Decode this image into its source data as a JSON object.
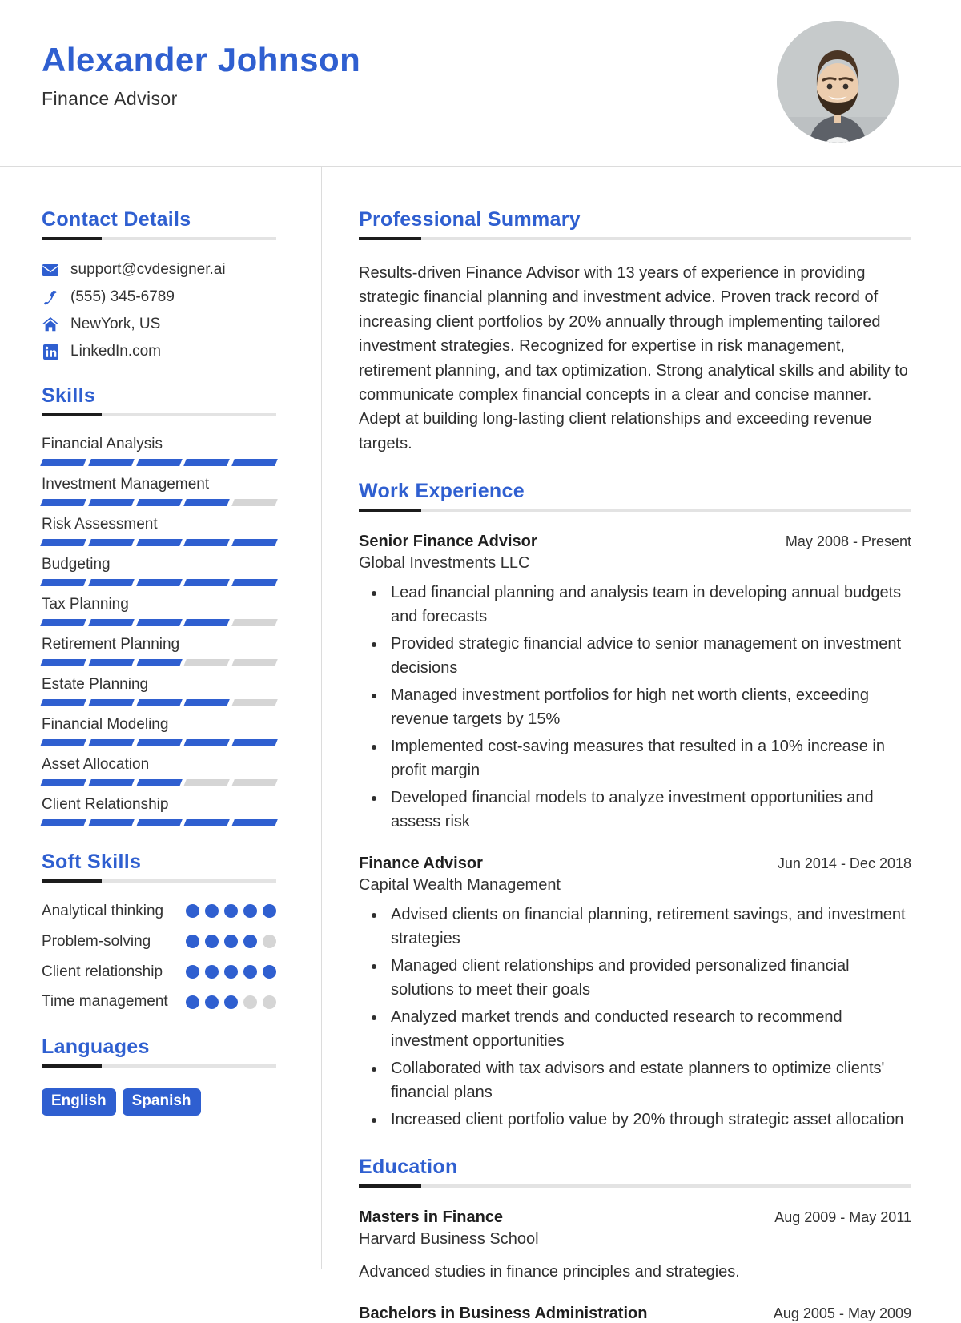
{
  "theme": {
    "accent": "#2f5fd0",
    "rule_dark": "#1c1c1c",
    "rule_light": "#e3e3e3",
    "muted": "#d5d5d5"
  },
  "header": {
    "name": "Alexander Johnson",
    "job_title": "Finance Advisor",
    "avatar_icon": "profile-photo"
  },
  "sidebar": {
    "contact": {
      "heading": "Contact Details",
      "items": [
        {
          "icon": "envelope-icon",
          "text": "support@cvdesigner.ai"
        },
        {
          "icon": "phone-icon",
          "text": "(555) 345-6789"
        },
        {
          "icon": "home-icon",
          "text": "NewYork, US"
        },
        {
          "icon": "linkedin-icon",
          "text": "LinkedIn.com"
        }
      ]
    },
    "skills": {
      "heading": "Skills",
      "max": 5,
      "items": [
        {
          "label": "Financial Analysis",
          "level": 5
        },
        {
          "label": "Investment Management",
          "level": 4
        },
        {
          "label": "Risk Assessment",
          "level": 5
        },
        {
          "label": "Budgeting",
          "level": 5
        },
        {
          "label": "Tax Planning",
          "level": 4
        },
        {
          "label": "Retirement Planning",
          "level": 3
        },
        {
          "label": "Estate Planning",
          "level": 4
        },
        {
          "label": "Financial Modeling",
          "level": 5
        },
        {
          "label": "Asset Allocation",
          "level": 3
        },
        {
          "label": "Client Relationship",
          "level": 5
        }
      ]
    },
    "soft_skills": {
      "heading": "Soft Skills",
      "max": 5,
      "items": [
        {
          "label": "Analytical thinking",
          "level": 5
        },
        {
          "label": "Problem-solving",
          "level": 4
        },
        {
          "label": "Client relationship",
          "level": 5
        },
        {
          "label": "Time management",
          "level": 3
        }
      ]
    },
    "languages": {
      "heading": "Languages",
      "items": [
        "English",
        "Spanish"
      ]
    }
  },
  "main": {
    "summary": {
      "heading": "Professional Summary",
      "text": "Results-driven Finance Advisor with 13 years of experience in providing strategic financial planning and investment advice. Proven track record of increasing client portfolios by 20% annually through implementing tailored investment strategies. Recognized for expertise in risk management, retirement planning, and tax optimization. Strong analytical skills and ability to communicate complex financial concepts in a clear and concise manner. Adept at building long-lasting client relationships and exceeding revenue targets."
    },
    "experience": {
      "heading": "Work Experience",
      "items": [
        {
          "title": "Senior Finance Advisor",
          "company": "Global Investments LLC",
          "date": "May 2008 - Present",
          "bullets": [
            "Lead financial planning and analysis team in developing annual budgets and forecasts",
            "Provided strategic financial advice to senior management on investment decisions",
            "Managed investment portfolios for high net worth clients, exceeding revenue targets by 15%",
            "Implemented cost-saving measures that resulted in a 10% increase in profit margin",
            "Developed financial models to analyze investment opportunities and assess risk"
          ]
        },
        {
          "title": "Finance Advisor",
          "company": "Capital Wealth Management",
          "date": "Jun 2014 - Dec 2018",
          "bullets": [
            "Advised clients on financial planning, retirement savings, and investment strategies",
            "Managed client relationships and provided personalized financial solutions to meet their goals",
            "Analyzed market trends and conducted research to recommend investment opportunities",
            "Collaborated with tax advisors and estate planners to optimize clients' financial plans",
            "Increased client portfolio value by 20% through strategic asset allocation"
          ]
        }
      ]
    },
    "education": {
      "heading": "Education",
      "items": [
        {
          "degree": "Masters in Finance",
          "school": "Harvard Business School",
          "date": "Aug 2009 - May 2011",
          "description": "Advanced studies in finance principles and strategies."
        },
        {
          "degree": "Bachelors in Business Administration",
          "school": "",
          "date": "Aug 2005 - May 2009",
          "description": ""
        }
      ]
    }
  }
}
